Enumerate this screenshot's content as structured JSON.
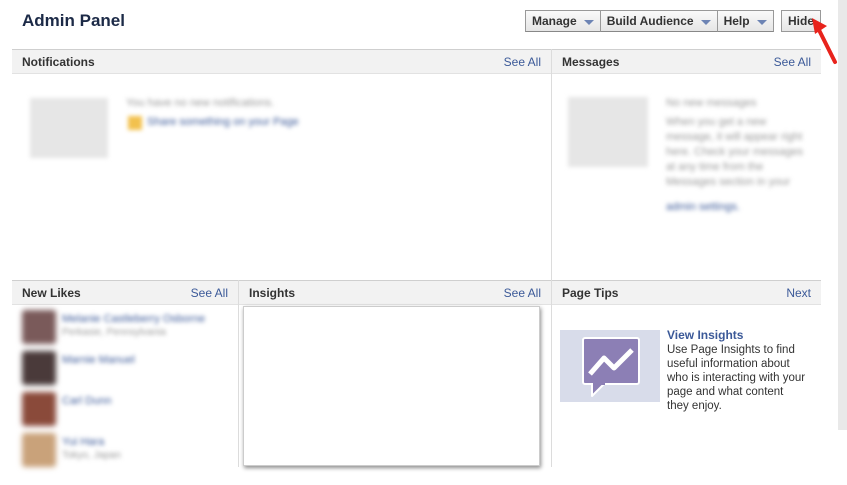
{
  "header": {
    "title": "Admin Panel",
    "menus": [
      {
        "label": "Manage"
      },
      {
        "label": "Build Audience"
      },
      {
        "label": "Help"
      }
    ],
    "hide_label": "Hide"
  },
  "notifications": {
    "heading": "Notifications",
    "see_all": "See All",
    "empty_text": "You have no new notifications.",
    "share_link": "Share something on your Page"
  },
  "messages": {
    "heading": "Messages",
    "see_all": "See All",
    "empty_title": "No new messages",
    "desc": "When you get a new message, it will appear right here. Check your messages at any time from the Messages section in your",
    "desc_link": "admin settings."
  },
  "new_likes": {
    "heading": "New Likes",
    "see_all": "See All",
    "items": [
      {
        "name": "Melanie Castleberry Osborne",
        "sub": "Perkasie, Pennsylvania"
      },
      {
        "name": "Marnie Manuel",
        "sub": ""
      },
      {
        "name": "Carl Dunn",
        "sub": ""
      },
      {
        "name": "Yui Hara",
        "sub": "Tokyo, Japan"
      }
    ]
  },
  "insights": {
    "heading": "Insights",
    "see_all": "See All"
  },
  "page_tips": {
    "heading": "Page Tips",
    "next": "Next",
    "tip_title": "View Insights",
    "tip_desc": "Use Page Insights to find useful information about who is interacting with your page and what content they enjoy."
  },
  "colors": {
    "link": "#3b5998",
    "header_bg": "#f2f2f2",
    "arrow": "#e8231c",
    "tip_icon_bg": "#8c7fb5"
  }
}
